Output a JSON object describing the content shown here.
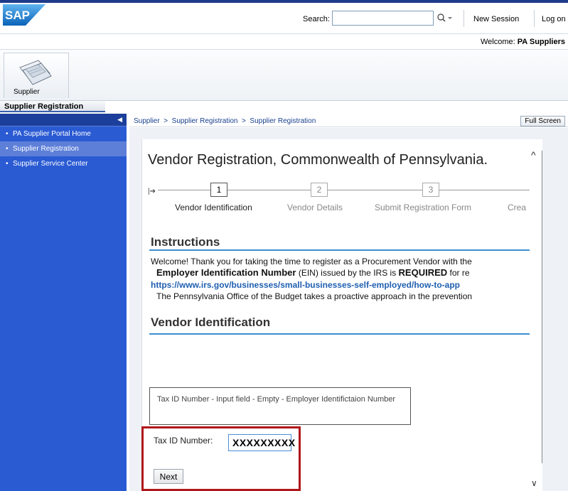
{
  "header": {
    "logo_text": "SAP",
    "search_label": "Search:",
    "search_value": "",
    "search_button_icon": "magnifier-dropdown-icon",
    "new_session": "New Session",
    "log_on": "Log on",
    "welcome_prefix": "Welcome:",
    "welcome_user": "PA Suppliers",
    "brand_color": "#1e3a8a"
  },
  "workset": {
    "icon": "supplier-pages-icon",
    "label": "Supplier",
    "subnav_tab": "Supplier Registration"
  },
  "sidebar": {
    "collapse_icon": "triangle-left-icon",
    "items": [
      {
        "label": "PA Supplier Portal Home",
        "selected": false
      },
      {
        "label": "Supplier Registration",
        "selected": true
      },
      {
        "label": "Supplier Service Center",
        "selected": false
      }
    ],
    "bg_color": "#2b5bd3"
  },
  "breadcrumb": {
    "text": "Supplier  >  Supplier Registration  >  Supplier Registration",
    "full_screen": "Full Screen"
  },
  "page": {
    "title": "Vendor Registration, Commonwealth of Pennsylvania.",
    "steps": [
      {
        "number": "1",
        "label": "Vendor Identification",
        "active": true
      },
      {
        "number": "2",
        "label": "Vendor Details",
        "active": false
      },
      {
        "number": "3",
        "label": "Submit Registration Form",
        "active": false
      },
      {
        "number": "",
        "label": "Crea",
        "active": false
      }
    ],
    "instructions_heading": "Instructions",
    "instr_line1": "Welcome! Thank you for taking the time to register as a Procurement Vendor with the",
    "instr_line2_bold": "Employer Identification Number",
    "instr_line2_rest": " (EIN) issued by the IRS is ",
    "instr_line2_required": "REQUIRED",
    "instr_line2_tail": " for re",
    "instr_link": "https://www.irs.gov/businesses/small-businesses-self-employed/how-to-app",
    "instr_line4": "The Pennsylvania Office of the Budget takes a proactive approach in the prevention",
    "vendor_id_heading": "Vendor Identification",
    "tooltip_text": "Tax ID Number - Input field - Empty - Employer Identifictaion Number",
    "tax_label": "Tax ID Number:",
    "tax_value": "XXXXXXXXX",
    "next_button": "Next",
    "highlight_color": "#b0171a",
    "heading_rule_color": "#3d8fd0"
  }
}
